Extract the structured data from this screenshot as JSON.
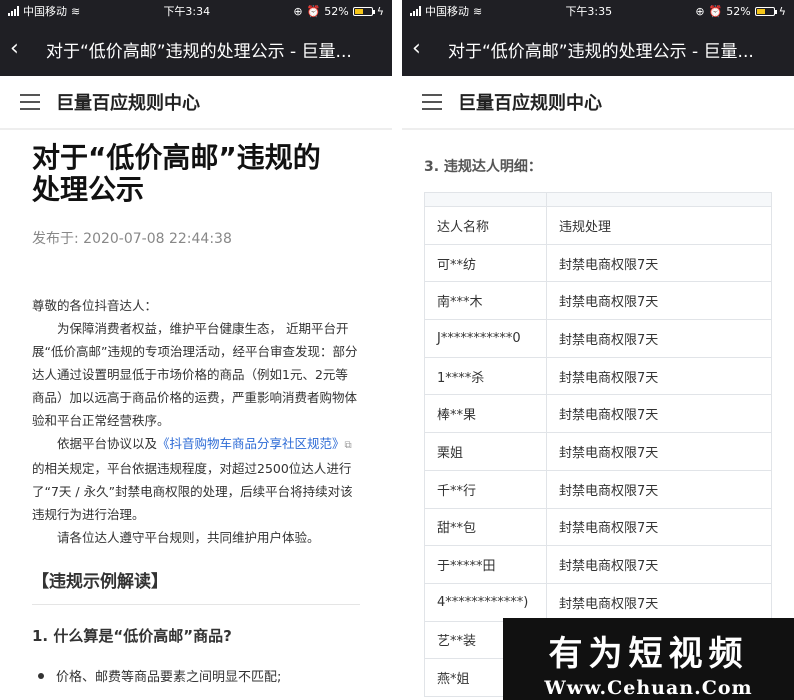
{
  "colors": {
    "topbar": "#1f1f24",
    "link": "#2d6bd6",
    "battery": "#f5c518"
  },
  "left": {
    "status": {
      "carrier": "中国移动",
      "time": "下午3:34",
      "battery": "52%",
      "battery_level": 0.52
    },
    "window_title": "对于“低价高邮”违规的处理公示 - 巨量...",
    "site_name": "巨量百应规则中心",
    "article": {
      "title_line1": "对于“低价高邮”违规的",
      "title_line2": "处理公示",
      "published": "发布于: 2020-07-08 22:44:38",
      "greeting": "尊敬的各位抖音达人：",
      "p1": "为保障消费者权益，维护平台健康生态， 近期平台开展“低价高邮”违规的专项治理活动，经平台审查发现：部分达人通过设置明显低于市场价格的商品（例如1元、2元等商品）加以远高于商品价格的运费，严重影响消费者购物体验和平台正常经营秩序。",
      "p2_before": "依据平台协议以及",
      "p2_link": "《抖音购物车商品分享社区规范》",
      "p2_after": "的相关规定，平台依据违规程度，对超过2500位达人进行了“7天 / 永久”封禁电商权限的处理，后续平台将持续对该违规行为进行治理。",
      "p3": "请各位达人遵守平台规则，共同维护用户体验。",
      "section_heading": "【违规示例解读】",
      "question1": "1. 什么算是“低价高邮”商品?",
      "bullet1": "价格、邮费等商品要素之间明显不匹配;"
    }
  },
  "right": {
    "status": {
      "carrier": "中国移动",
      "time": "下午3:35",
      "battery": "52%",
      "battery_level": 0.52
    },
    "window_title": "对于“低价高邮”违规的处理公示 - 巨量...",
    "site_name": "巨量百应规则中心",
    "detail_heading": "3. 违规达人明细：",
    "table_headers": [
      "达人名称",
      "违规处理"
    ],
    "table_rows": [
      [
        "可**纺",
        "封禁电商权限7天"
      ],
      [
        "南***木",
        "封禁电商权限7天"
      ],
      [
        "J***********0",
        "封禁电商权限7天"
      ],
      [
        "1****杀",
        "封禁电商权限7天"
      ],
      [
        "棒**果",
        "封禁电商权限7天"
      ],
      [
        "栗姐",
        "封禁电商权限7天"
      ],
      [
        "千**行",
        "封禁电商权限7天"
      ],
      [
        "甜**包",
        "封禁电商权限7天"
      ],
      [
        "于*****田",
        "封禁电商权限7天"
      ],
      [
        "4************)",
        "封禁电商权限7天"
      ],
      [
        "艺**装",
        ""
      ],
      [
        "燕*姐",
        ""
      ]
    ]
  },
  "watermark": {
    "line1": "有为短视频",
    "line2": "Www.Cehuan.Com"
  }
}
